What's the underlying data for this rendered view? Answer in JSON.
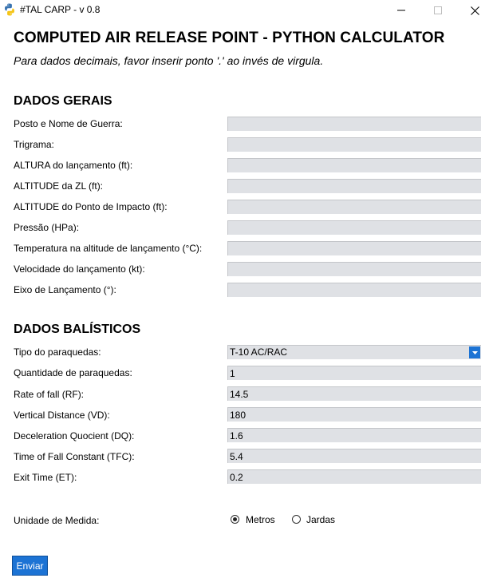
{
  "window": {
    "title": "#TAL CARP - v 0.8",
    "icon": "python-icon",
    "controls": [
      "minimize-icon",
      "maximize-icon",
      "close-icon"
    ]
  },
  "header": {
    "title": "COMPUTED AIR RELEASE POINT - PYTHON CALCULATOR",
    "subtitle": "Para dados decimais, favor inserir ponto '.' ao invés de virgula."
  },
  "dados_gerais": {
    "title": "DADOS GERAIS",
    "fields": [
      {
        "label": "Posto e Nome de Guerra:",
        "value": ""
      },
      {
        "label": "Trigrama:",
        "value": ""
      },
      {
        "label": "ALTURA do lançamento (ft):",
        "value": ""
      },
      {
        "label": "ALTITUDE da ZL (ft):",
        "value": ""
      },
      {
        "label": "ALTITUDE do Ponto de Impacto (ft):",
        "value": ""
      },
      {
        "label": "Pressão (HPa):",
        "value": ""
      },
      {
        "label": "Temperatura na altitude de lançamento (°C):",
        "value": ""
      },
      {
        "label": "Velocidade do lançamento (kt):",
        "value": ""
      },
      {
        "label": "Eixo de Lançamento (°):",
        "value": ""
      }
    ]
  },
  "dados_balisticos": {
    "title": "DADOS BALÍSTICOS",
    "tipo": {
      "label": "Tipo do paraquedas:",
      "value": "T-10 AC/RAC"
    },
    "fields": [
      {
        "label": "Quantidade de paraquedas:",
        "value": "1"
      },
      {
        "label": "Rate of fall (RF):",
        "value": "14.5"
      },
      {
        "label": "Vertical Distance (VD):",
        "value": "180"
      },
      {
        "label": "Deceleration Quocient (DQ):",
        "value": "1.6"
      },
      {
        "label": "Time of Fall Constant (TFC):",
        "value": "5.4"
      },
      {
        "label": "Exit Time (ET):",
        "value": "0.2"
      }
    ]
  },
  "unidade": {
    "label": "Unidade de Medida:",
    "options": [
      "Metros",
      "Jardas"
    ],
    "selected": "Metros"
  },
  "submit": {
    "label": "Enviar"
  },
  "colors": {
    "accent": "#1c73d4",
    "field_bg": "#dfe1e5"
  }
}
